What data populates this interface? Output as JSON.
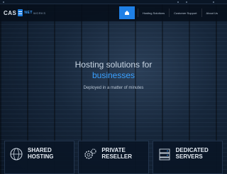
{
  "header": {
    "logo_left": "CAS",
    "logo_right": "NET",
    "logo_sub": "WORKS",
    "nav_items": [
      "Hosting Solutions",
      "Customer Support",
      "About Us"
    ]
  },
  "hero": {
    "title": "Hosting solutions for",
    "subtitle": "businesses",
    "tagline": "Deployed in a matter of minutes"
  },
  "cards": [
    {
      "title_line1": "SHARED",
      "title_line2": "HOSTING",
      "icon": "globe-icon"
    },
    {
      "title_line1": "PRIVATE",
      "title_line2": "RESELLER",
      "icon": "gear-icon"
    },
    {
      "title_line1": "DEDICATED",
      "title_line2": "SERVERS",
      "icon": "server-icon"
    }
  ],
  "colors": {
    "accent": "#1f80e6",
    "highlight": "#3aa0ff",
    "background": "#0b1a2c"
  }
}
